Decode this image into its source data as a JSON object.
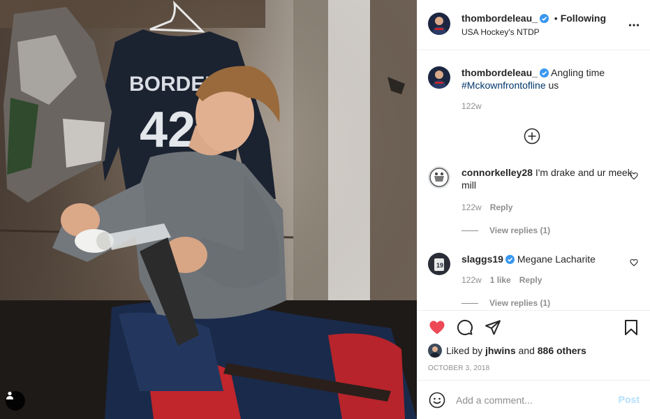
{
  "post": {
    "author": "thombordeleau_",
    "dot": "•",
    "follow_status": "Following",
    "location": "USA Hockey's NTDP"
  },
  "photo": {
    "jersey_name": "BORDELE",
    "jersey_number": "42"
  },
  "caption": {
    "user": "thombordeleau_",
    "text": "Angling time",
    "hashtag": "#Mckownfrontofline",
    "tail": " us",
    "time": "122w"
  },
  "comments": [
    {
      "user": "connorkelley28",
      "text": "I'm drake and ur meek mill",
      "time": "122w",
      "reply_label": "Reply",
      "view_replies": "View replies (1)"
    },
    {
      "user": "slaggs19",
      "text": "Megane Lacharite",
      "time": "122w",
      "likes": "1 like",
      "reply_label": "Reply",
      "view_replies": "View replies (1)"
    }
  ],
  "likes": {
    "prefix": "Liked by ",
    "user": "jhwins",
    "middle": " and ",
    "others": "886 others"
  },
  "date": "OCTOBER 3, 2018",
  "add_comment": {
    "placeholder": "Add a comment...",
    "post_label": "Post"
  },
  "colors": {
    "like_red": "#ed4956",
    "verified_blue": "#3897f0",
    "hashtag": "#00376b",
    "muted": "#8e8e8e",
    "post_disabled": "#b2dffc"
  },
  "icons": [
    "user-tag-icon",
    "more-options-icon",
    "verified-badge-icon",
    "load-more-plus-icon",
    "heart-icon",
    "comment-icon",
    "share-icon",
    "bookmark-icon",
    "emoji-icon"
  ]
}
